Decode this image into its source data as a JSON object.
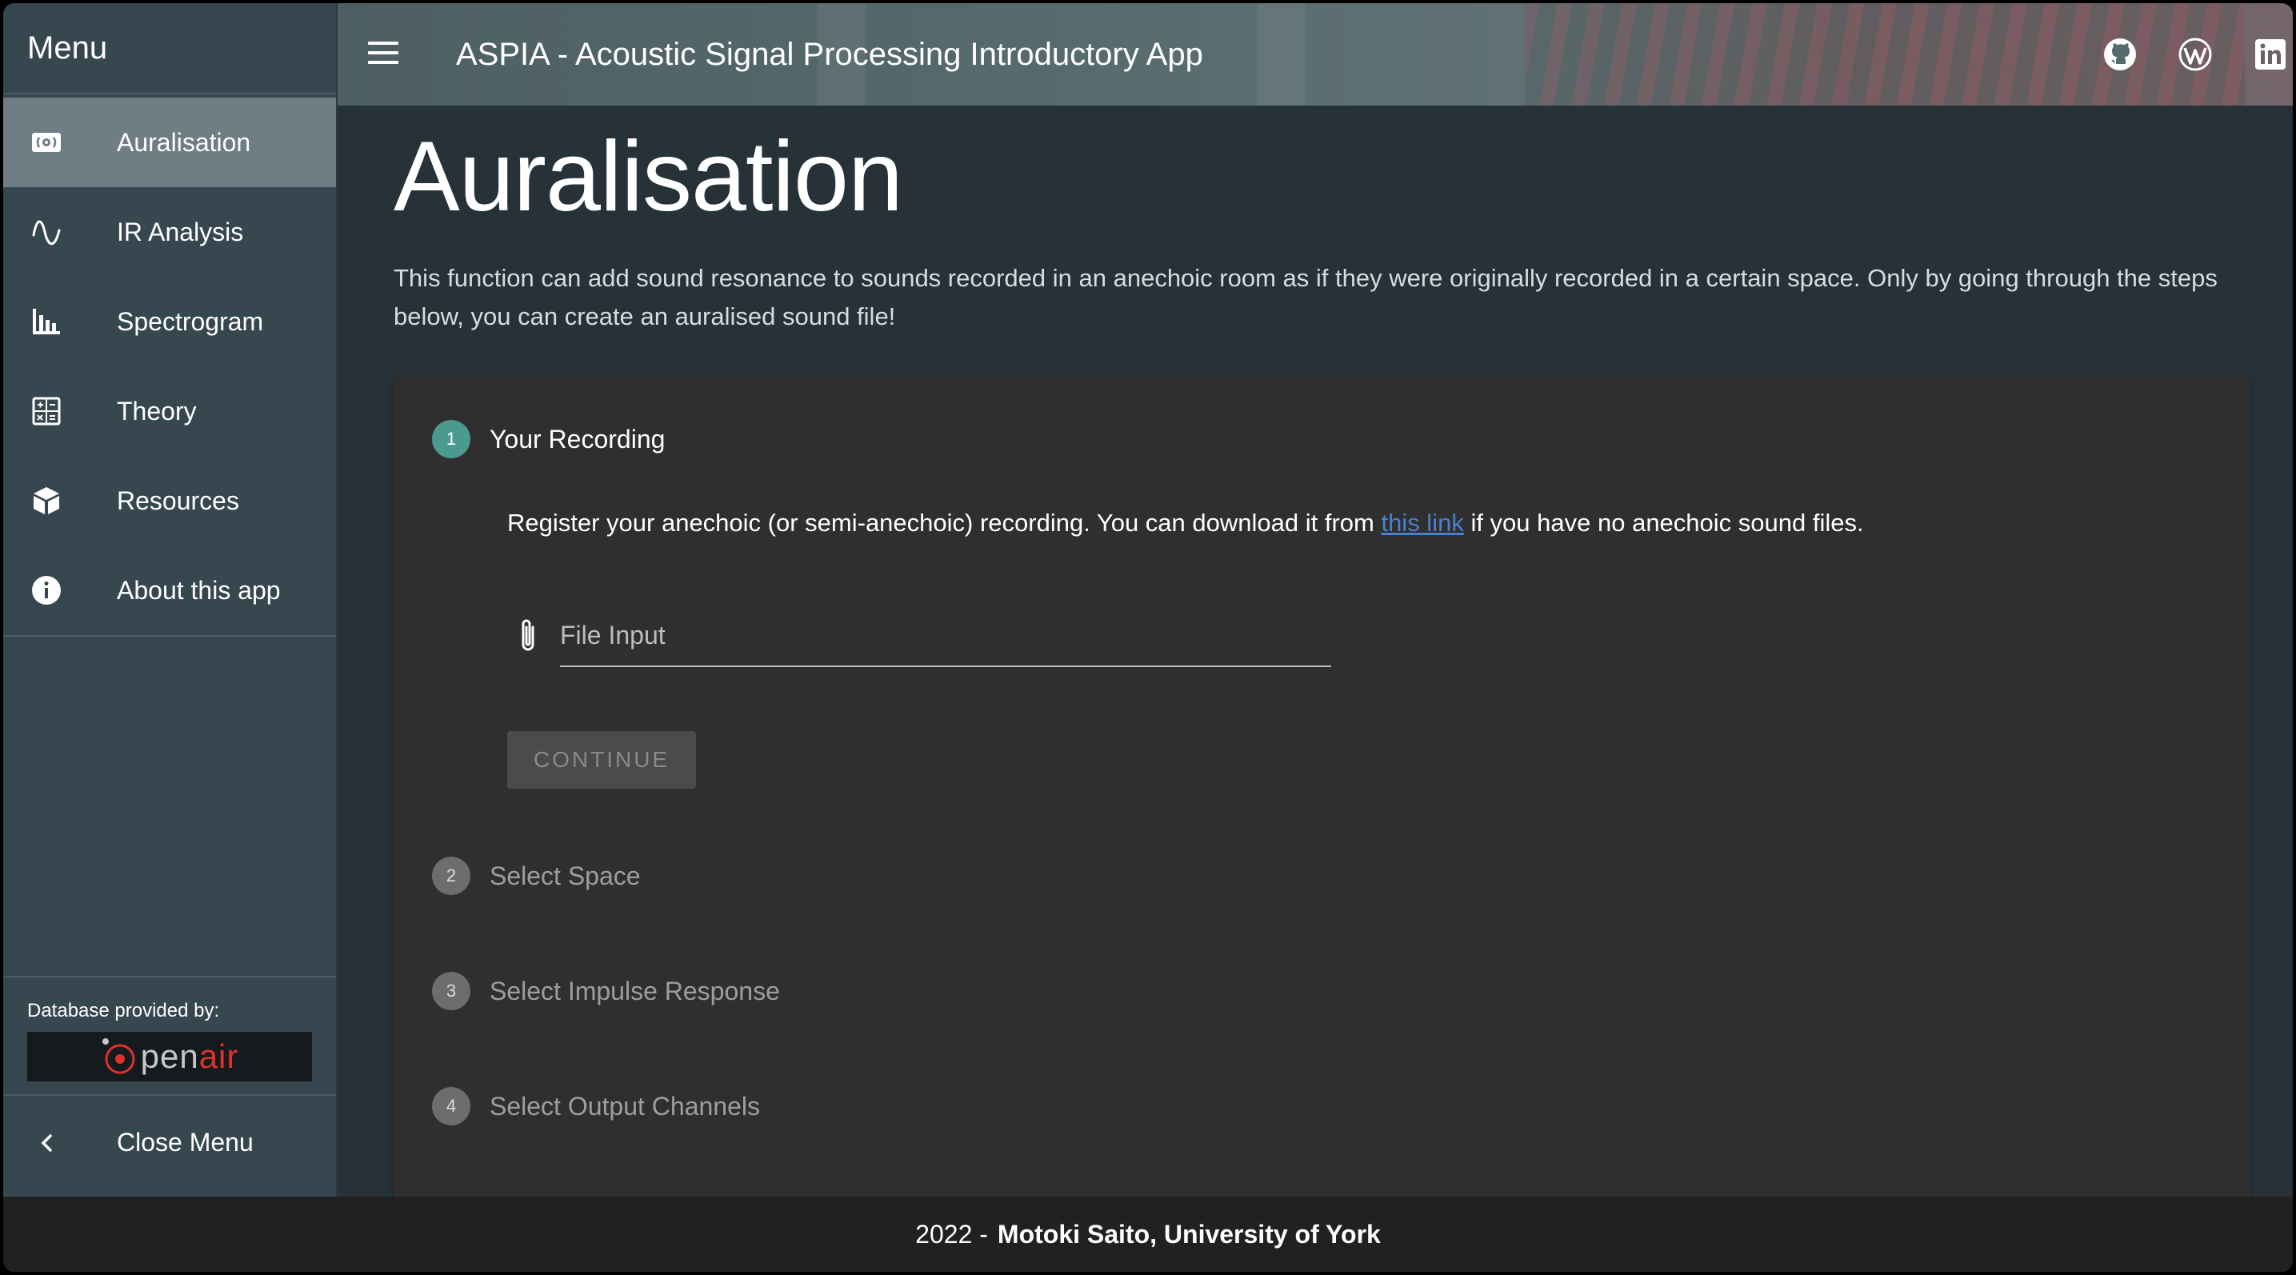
{
  "sidebar": {
    "header": "Menu",
    "items": [
      {
        "label": "Auralisation",
        "icon": "surround-sound-icon",
        "active": true
      },
      {
        "label": "IR Analysis",
        "icon": "sine-wave-icon",
        "active": false
      },
      {
        "label": "Spectrogram",
        "icon": "bar-chart-icon",
        "active": false
      },
      {
        "label": "Theory",
        "icon": "calculator-icon",
        "active": false
      },
      {
        "label": "Resources",
        "icon": "cube-icon",
        "active": false
      },
      {
        "label": "About this app",
        "icon": "info-icon",
        "active": false
      }
    ],
    "database_label": "Database provided by:",
    "logo": {
      "prefix": "pen",
      "suffix": "air"
    },
    "close_menu": "Close Menu"
  },
  "topbar": {
    "title": "ASPIA - Acoustic Signal Processing Introductory App",
    "icons": [
      "github-icon",
      "wordpress-icon",
      "linkedin-icon"
    ]
  },
  "main": {
    "title": "Auralisation",
    "intro": "This function can add sound resonance to sounds recorded in an anechoic room as if they were originally recorded in a certain space. Only by going through the steps below, you can create an auralised sound file!",
    "steps": [
      {
        "number": "1",
        "label": "Your Recording",
        "active": true
      },
      {
        "number": "2",
        "label": "Select Space",
        "active": false
      },
      {
        "number": "3",
        "label": "Select Impulse Response",
        "active": false
      },
      {
        "number": "4",
        "label": "Select Output Channels",
        "active": false
      }
    ],
    "register_text_before": "Register your anechoic (or semi-anechoic) recording. You can download it from ",
    "register_link": "this link",
    "register_text_after": " if you have no anechoic sound files.",
    "file_input_placeholder": "File Input",
    "continue_label": "CONTINUE"
  },
  "footer": {
    "year": "2022 -",
    "author": "Motoki Saito, University of York"
  },
  "colors": {
    "sidebar": "#37474f",
    "main_bg": "#263238",
    "active_step": "#4a9a8f",
    "link": "#4a7fd0",
    "openair_red": "#e0322a"
  }
}
